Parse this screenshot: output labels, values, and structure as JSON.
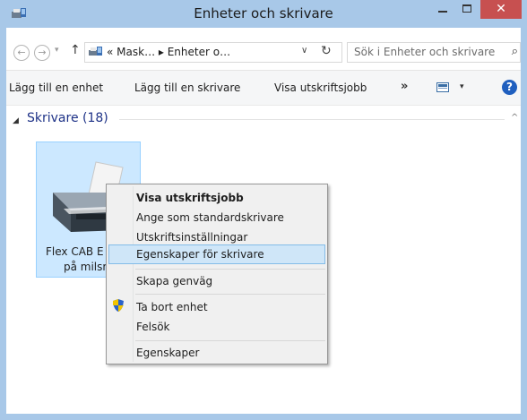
{
  "window": {
    "title": "Enheter och skrivare",
    "close_glyph": "✕"
  },
  "address": {
    "back_glyph": "←",
    "forward_glyph": "→",
    "dropdown_glyph": "▾",
    "up_glyph": "↑",
    "path": "« Mask… ▸ Enheter o…",
    "path_dropdown_glyph": "∨",
    "refresh_glyph": "↻",
    "search_placeholder": "Sök i Enheter och skrivare",
    "search_glyph": "⌕"
  },
  "commandbar": {
    "add_device": "Lägg till en enhet",
    "add_printer": "Lägg till en skrivare",
    "print_jobs": "Visa utskriftsjobb",
    "more": "»",
    "view_dropdown": "▾",
    "help": "?"
  },
  "group": {
    "arrow": "◢",
    "label": "Skrivare (18)",
    "scroll_up": "^"
  },
  "printer_tile": {
    "line1": "Flex CAB E",
    "line2": "på milsrv"
  },
  "hidden_label": "",
  "context_menu": {
    "items": [
      {
        "label": "Visa utskriftsjobb"
      },
      {
        "label": "Ange som standardskrivare"
      },
      {
        "label": "Utskriftsinställningar"
      },
      {
        "label": "Egenskaper för skrivare"
      },
      {
        "label": "Skapa genväg"
      },
      {
        "label": "Ta bort enhet"
      },
      {
        "label": "Felsök"
      },
      {
        "label": "Egenskaper"
      }
    ]
  },
  "colors": {
    "frame": "#a8c8e8",
    "close": "#c75050",
    "selection": "#cce8ff",
    "menu_highlight": "#cfe6f8",
    "group_header": "#1e3287"
  },
  "icons": {
    "title": "devices-printers-icon",
    "address": "devices-printers-icon",
    "view": "view-options-icon",
    "help": "help-icon",
    "shield": "uac-shield-icon",
    "printer": "printer-icon"
  }
}
